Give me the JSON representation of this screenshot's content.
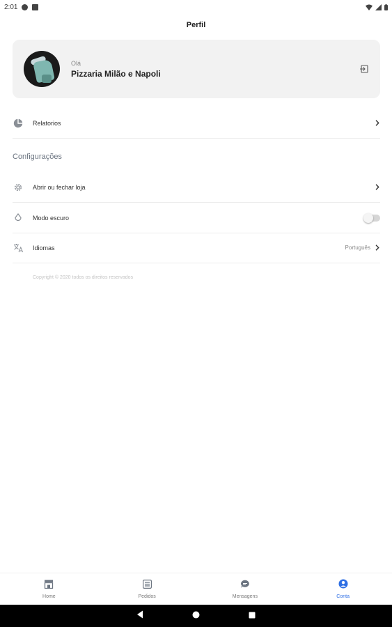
{
  "status_bar": {
    "time": "2:01"
  },
  "header": {
    "title": "Perfil"
  },
  "profile": {
    "greeting": "Olá",
    "name": "Pizzaria Milão e Napoli",
    "logout_icon": "logout-icon"
  },
  "menu": {
    "reports": {
      "label": "Relatorios",
      "icon": "chart-pie-icon"
    }
  },
  "settings": {
    "section_title": "Configurações",
    "items": [
      {
        "label": "Abrir ou fechar loja",
        "icon": "gear-icon"
      },
      {
        "label": "Modo escuro",
        "icon": "drop-icon",
        "toggle_on": false
      },
      {
        "label": "Idiomas",
        "icon": "translate-icon",
        "value": "Português"
      }
    ]
  },
  "copyright": "Copyright © 2020 todos os direitos reservados",
  "bottom_nav": {
    "items": [
      {
        "label": "Home",
        "icon": "store-icon",
        "active": false
      },
      {
        "label": "Pedidos",
        "icon": "list-icon",
        "active": false
      },
      {
        "label": "Mensagens",
        "icon": "chat-icon",
        "active": false
      },
      {
        "label": "Conta",
        "icon": "account-icon",
        "active": true
      }
    ]
  },
  "colors": {
    "accent": "#2f6fe4",
    "card_bg": "#f2f2f2",
    "section_title": "#6b7480"
  }
}
